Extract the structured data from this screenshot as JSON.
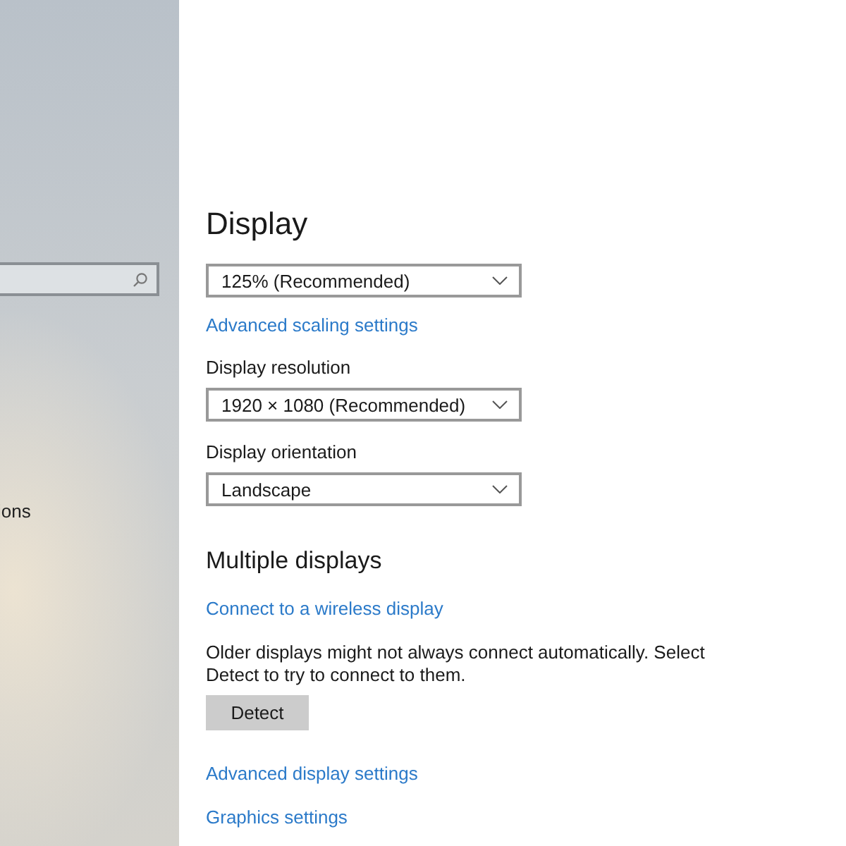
{
  "sidebar": {
    "items": [
      {
        "label": "ions"
      }
    ]
  },
  "title": "Display",
  "sections": [
    {
      "kind": "dropdown",
      "value": "125% (Recommended)"
    },
    {
      "kind": "link",
      "text": "Advanced scaling settings"
    },
    {
      "kind": "dropdown",
      "label": "Display resolution",
      "value": "1920 × 1080 (Recommended)"
    },
    {
      "kind": "dropdown",
      "label": "Display orientation",
      "value": "Landscape"
    },
    {
      "kind": "heading",
      "text": "Multiple displays"
    },
    {
      "kind": "link",
      "text": "Connect to a wireless display"
    },
    {
      "kind": "text",
      "text": "Older displays might not always connect automatically. Select Detect to try to connect to them."
    },
    {
      "kind": "button",
      "text": "Detect"
    },
    {
      "kind": "link",
      "text": "Advanced display settings"
    },
    {
      "kind": "link",
      "text": "Graphics settings"
    }
  ]
}
